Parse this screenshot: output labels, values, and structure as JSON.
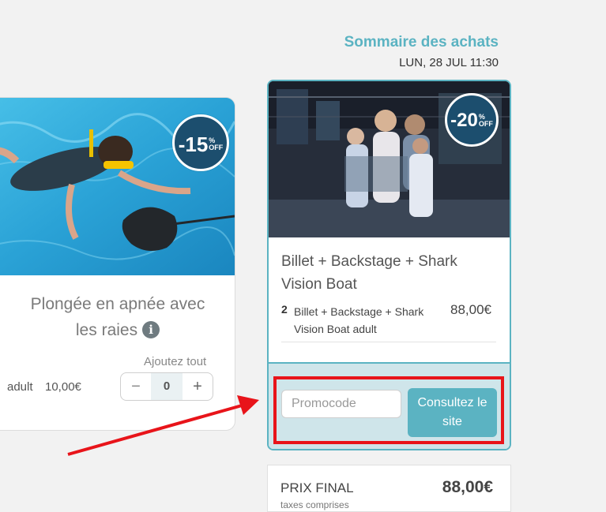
{
  "left_product": {
    "title_line1": "Plongée en apnée avec",
    "title_line2": "les raies",
    "info_icon": "info-icon",
    "discount_badge": "-15",
    "add_all_label": "Ajoutez tout",
    "ticket_type": "adult",
    "ticket_price": "10,00€",
    "quantity": "0",
    "minus_label": "−",
    "plus_label": "+"
  },
  "summary": {
    "title": "Sommaire des achats",
    "date": "LUN, 28 JUL 11:30"
  },
  "right_product": {
    "discount_badge": "-20",
    "title": "Billet + Backstage + Shark Vision Boat",
    "line_quantity": "2",
    "line_name": "Billet + Backstage + Shark Vision Boat adult",
    "line_price": "88,00€"
  },
  "promo": {
    "placeholder": "Promocode",
    "button_label": "Consultez le site"
  },
  "final": {
    "label": "PRIX FINAL",
    "sublabel": "taxes comprises",
    "price": "88,00€"
  },
  "colors": {
    "accent": "#5bb3c2",
    "badge": "#1c4e6e",
    "highlight": "#e8141a"
  }
}
